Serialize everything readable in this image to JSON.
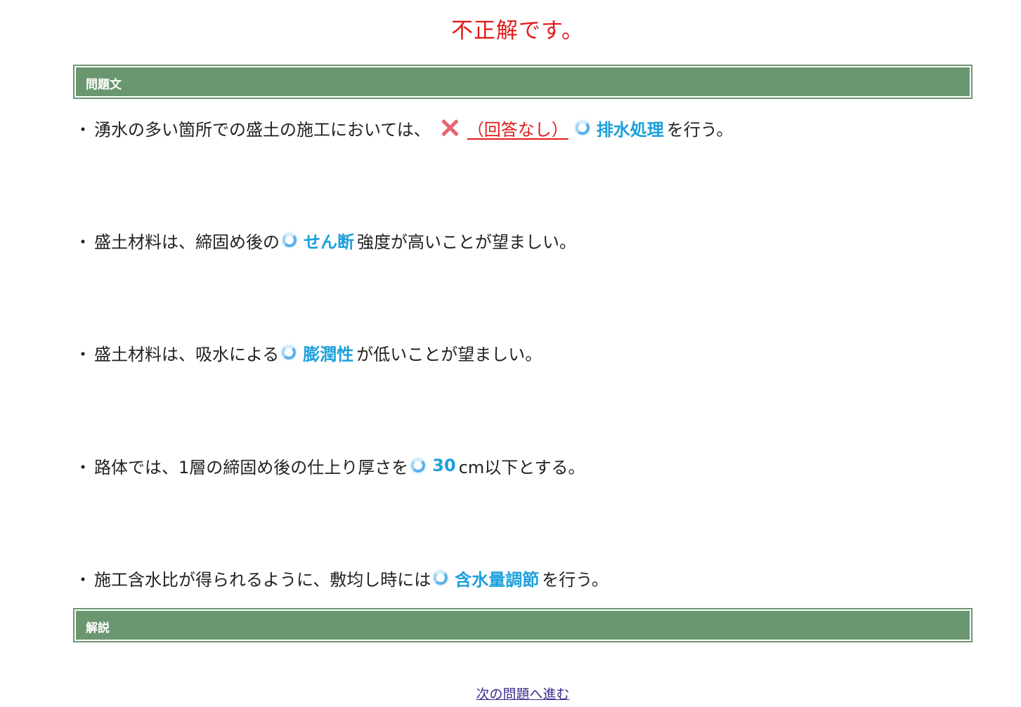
{
  "result": {
    "title": "不正解です。"
  },
  "sections": {
    "question_header": "問題文",
    "explanation_header": "解説"
  },
  "questions": [
    {
      "bullet": "・",
      "before": "湧水の多い箇所での盛土の施工においては、",
      "user_answer": "（回答なし）",
      "answer": "排水処理",
      "after": "を行う。"
    },
    {
      "bullet": "・",
      "before": "盛土材料は、締固め後の",
      "answer": "せん断",
      "after": "強度が高いことが望ましい。"
    },
    {
      "bullet": "・",
      "before": "盛土材料は、吸水による",
      "answer": "膨潤性",
      "after": "が低いことが望ましい。"
    },
    {
      "bullet": "・",
      "before": "路体では、1層の締固め後の仕上り厚さを",
      "answer": "30",
      "after": "cm以下とする。"
    },
    {
      "bullet": "・",
      "before": "施工含水比が得られるように、敷均し時には",
      "answer": "含水量調節",
      "after": "を行う。"
    }
  ],
  "navigation": {
    "next_label": "次の問題へ進む"
  },
  "icons": {
    "correct": "ring-icon",
    "incorrect": "cross-icon"
  },
  "colors": {
    "incorrect_text": "#e11b1b",
    "answer_text": "#1ba0dc",
    "header_bg": "#6a9670"
  }
}
